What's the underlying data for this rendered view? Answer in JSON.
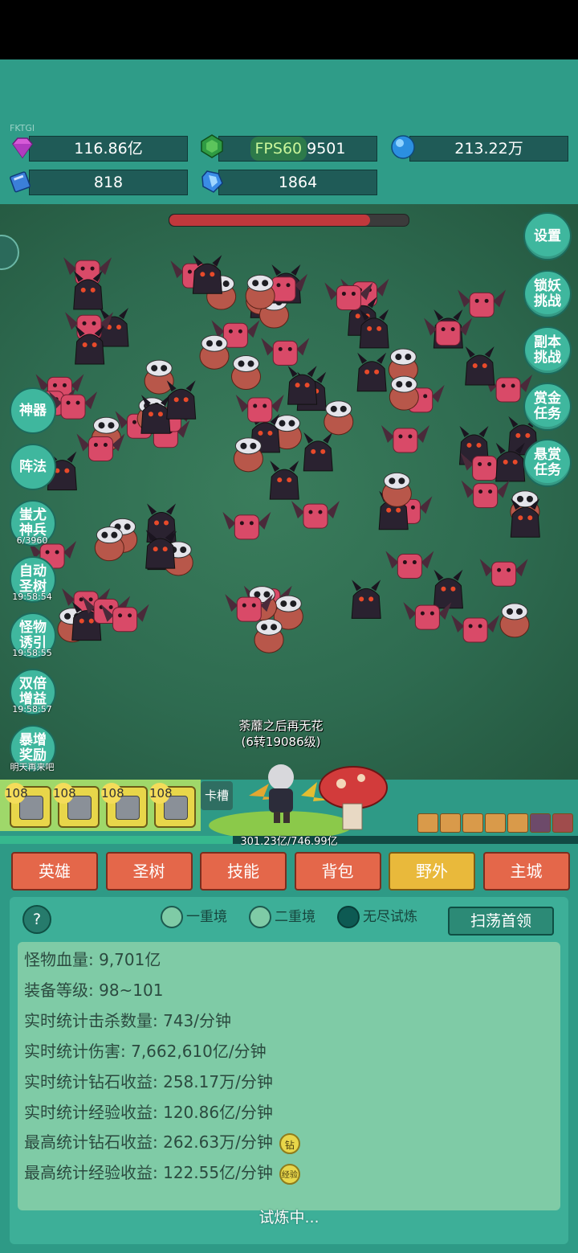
{
  "tag": "FKTGI",
  "resources": {
    "diamond": "116.86亿",
    "fps": "FPS60",
    "gem": "9501",
    "orb": "213.22万",
    "book": "818",
    "crystal": "1864"
  },
  "boss_hp_fraction": 0.84,
  "right_menu": [
    {
      "line1": "设置",
      "line2": ""
    },
    {
      "line1": "锁妖",
      "line2": "挑战"
    },
    {
      "line1": "副本",
      "line2": "挑战"
    },
    {
      "line1": "赏金",
      "line2": "任务"
    },
    {
      "line1": "悬赏",
      "line2": "任务"
    }
  ],
  "left_menu": [
    {
      "line1": "神器",
      "line2": "",
      "sub": ""
    },
    {
      "line1": "阵法",
      "line2": "",
      "sub": ""
    },
    {
      "line1": "蚩尤",
      "line2": "神兵",
      "sub": "6/3960"
    },
    {
      "line1": "自动",
      "line2": "圣树",
      "sub": "19:58:54"
    },
    {
      "line1": "怪物",
      "line2": "诱引",
      "sub": "19:58:55"
    },
    {
      "line1": "双倍",
      "line2": "增益",
      "sub": "19:58:57"
    },
    {
      "line1": "暴增",
      "line2": "奖励",
      "sub": "明天再来吧"
    }
  ],
  "hero": {
    "name": "荼蘼之后再无花",
    "level": "(6转19086级)"
  },
  "slots": [
    {
      "level": "108",
      "icon": "sword-icon"
    },
    {
      "level": "108",
      "icon": "armor-icon"
    },
    {
      "level": "108",
      "icon": "shield-icon"
    },
    {
      "level": "108",
      "icon": "boots-icon"
    }
  ],
  "slot_label": "卡槽",
  "exp": {
    "text": "301.23亿/746.99亿",
    "fraction": 0.403
  },
  "tabs": [
    "英雄",
    "圣树",
    "技能",
    "背包",
    "野外",
    "主城"
  ],
  "active_tab": "野外",
  "modes": [
    {
      "label": "一重境",
      "selected": false
    },
    {
      "label": "二重境",
      "selected": false
    },
    {
      "label": "无尽试炼",
      "selected": true
    }
  ],
  "help": "?",
  "sweep_button": "扫荡首领",
  "stats": [
    "怪物血量: 9,701亿",
    "装备等级: 98~101",
    "实时统计击杀数量: 743/分钟",
    "实时统计伤害: 7,662,610亿/分钟",
    "实时统计钻石收益: 258.17万/分钟",
    "实时统计经验收益: 120.86亿/分钟",
    "最高统计钻石收益: 262.63万/分钟",
    "最高统计经验收益: 122.55亿/分钟"
  ],
  "stat_badges": {
    "diamond": "钻",
    "exp": "经验"
  },
  "status": "试炼中..."
}
